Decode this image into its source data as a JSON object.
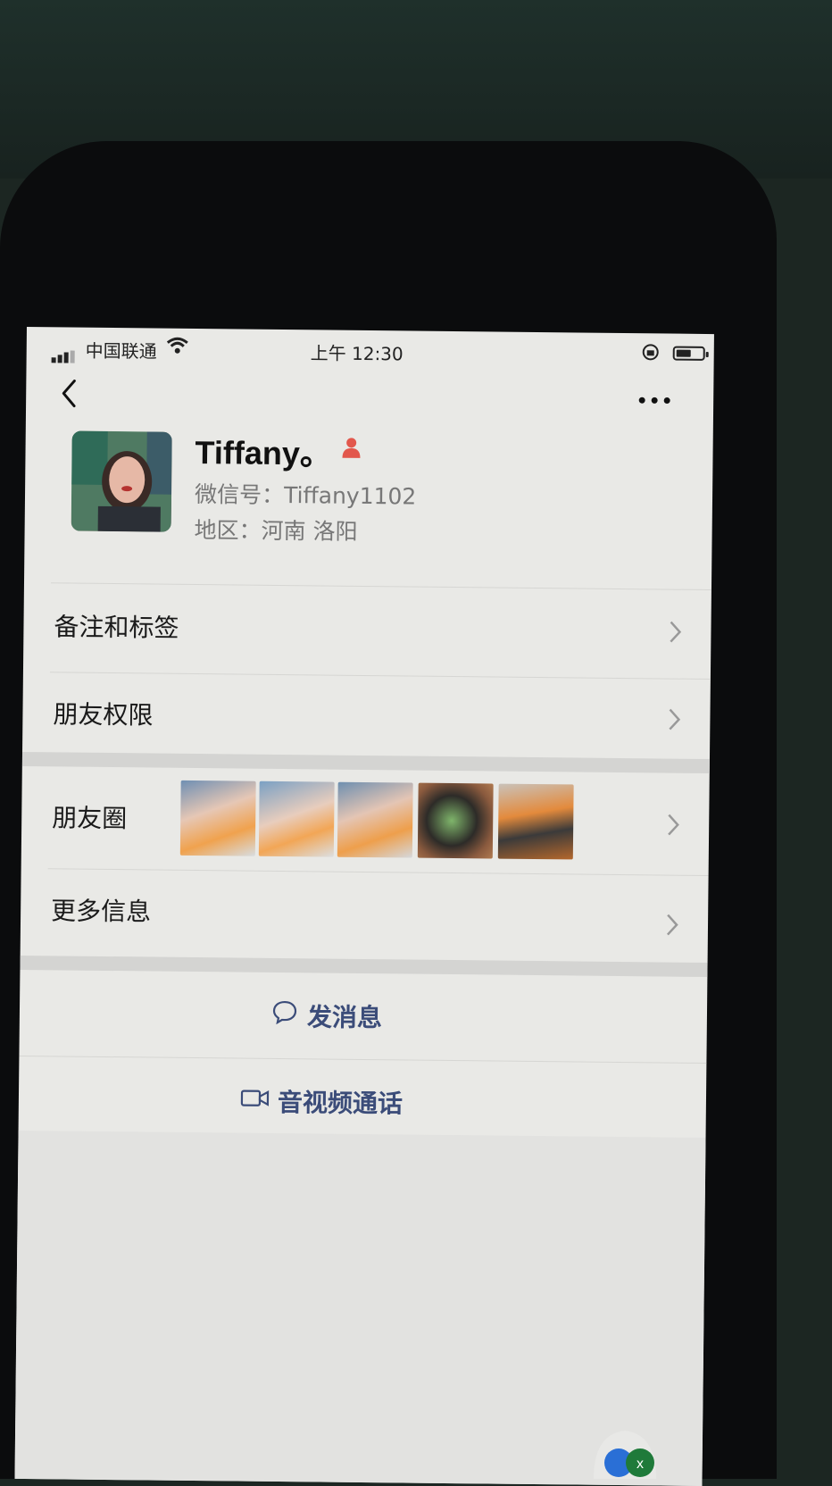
{
  "status_bar": {
    "carrier": "中国联通",
    "time": "上午 12:30"
  },
  "profile": {
    "name": "Tiffany。",
    "wechat_id_label": "微信号：",
    "wechat_id": "Tiffany1102",
    "region_label": "地区：",
    "region": "河南 洛阳"
  },
  "rows": {
    "remark_tags": "备注和标签",
    "friend_permissions": "朋友权限",
    "moments": "朋友圈",
    "more_info": "更多信息"
  },
  "actions": {
    "send_message": "发消息",
    "av_call": "音视频通话"
  },
  "colors": {
    "screen_bg": "#e9e9e6",
    "action_text": "#3b4c79",
    "gender_female": "#e2574c"
  },
  "icons": [
    "back-arrow-icon",
    "more-dots-icon",
    "gender-female-icon",
    "chevron-right-icon",
    "chat-bubble-icon",
    "video-camera-icon"
  ]
}
